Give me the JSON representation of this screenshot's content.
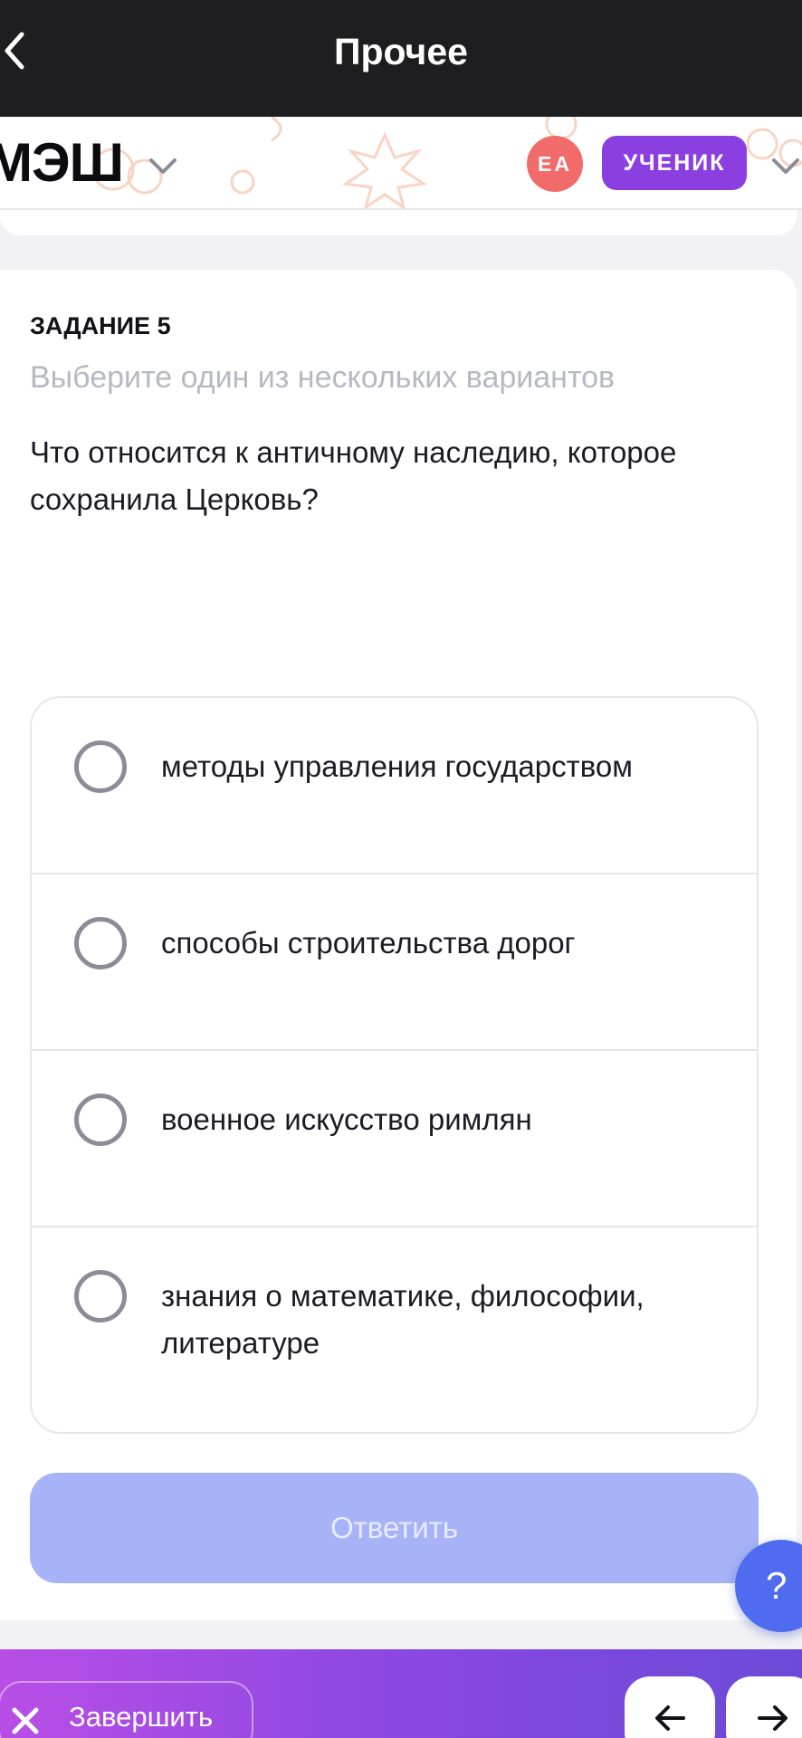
{
  "topbar": {
    "title": "Прочее"
  },
  "header": {
    "logo": "МЭШ",
    "avatar_initials": "ЕА",
    "role_label": "УЧЕНИК"
  },
  "task": {
    "title": "ЗАДАНИЕ 5",
    "hint": "Выберите один из нескольких вариантов",
    "question": "Что относится к античному наследию, которое сохранила Церковь?",
    "options": [
      {
        "label": "методы управления государством"
      },
      {
        "label": "способы строительства дорог"
      },
      {
        "label": "военное искусство римлян"
      },
      {
        "label": "знания о математике, философии, литературе"
      }
    ],
    "answer_label": "Ответить"
  },
  "help": {
    "label": "?"
  },
  "bottombar": {
    "finish_label": "Завершить"
  },
  "colors": {
    "topbar_bg": "#1e1e20",
    "role_button": "#8c3fe0",
    "avatar": "#f26b6b",
    "answer_button_disabled": "#a7b3f7",
    "help_button": "#4f6cf0",
    "bottom_gradient_start": "#b84ee6",
    "bottom_gradient_end": "#6c4ad8"
  }
}
